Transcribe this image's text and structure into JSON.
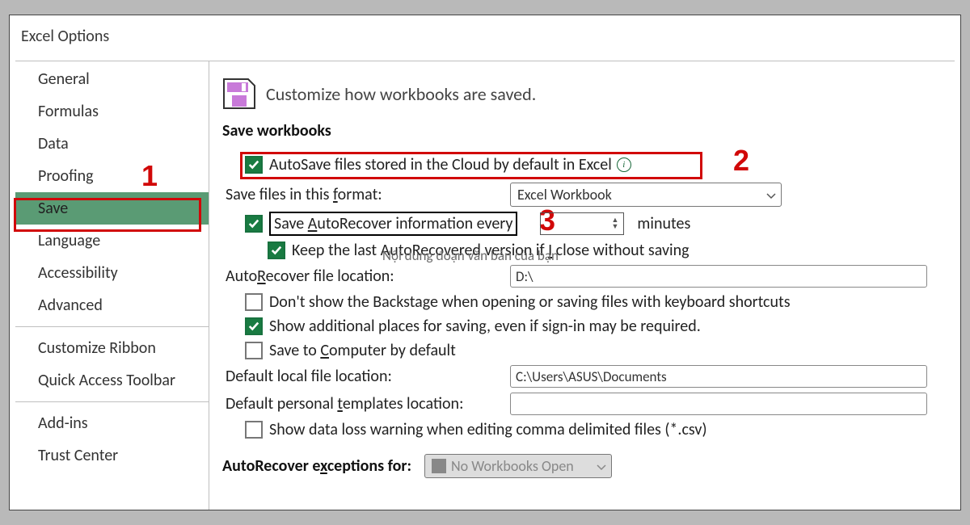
{
  "window_title": "Excel Options",
  "sidebar": {
    "items": [
      {
        "label": "General"
      },
      {
        "label": "Formulas"
      },
      {
        "label": "Data"
      },
      {
        "label": "Proofing"
      },
      {
        "label": "Save"
      },
      {
        "label": "Language"
      },
      {
        "label": "Accessibility"
      },
      {
        "label": "Advanced"
      },
      {
        "label": "Customize Ribbon"
      },
      {
        "label": "Quick Access Toolbar"
      },
      {
        "label": "Add-ins"
      },
      {
        "label": "Trust Center"
      }
    ]
  },
  "header_text": "Customize how workbooks are saved.",
  "sections": {
    "save_workbooks": {
      "title": "Save workbooks",
      "autosave_cloud_label": "AutoSave files stored in the Cloud by default in Excel",
      "format_label_pre": "Save files in this ",
      "format_label_u": "f",
      "format_label_post": "ormat:",
      "format_value": "Excel Workbook",
      "autorecover_label_pre": "Save ",
      "autorecover_label_u": "A",
      "autorecover_label_post": "utoRecover information every",
      "autorecover_value": "",
      "minutes_label": "minutes",
      "keep_last_label_pre": "Keep the last AutoRecovered version if ",
      "keep_last_label_u": "I",
      "keep_last_label_post": " close without saving",
      "ar_file_loc_label_pre": "Auto",
      "ar_file_loc_label_u": "R",
      "ar_file_loc_label_post": "ecover file location:",
      "ar_file_loc_value": "D:\\",
      "no_backstage_label": "Don't show the Backstage when opening or saving files with keyboard shortcuts",
      "show_places_label_pre": "Show additional places for saving, even if si",
      "show_places_label_u": "g",
      "show_places_label_post": "n-in may be required.",
      "save_computer_label_pre": "Save to ",
      "save_computer_label_u": "C",
      "save_computer_label_post": "omputer by default",
      "default_local_label": "Default local file location:",
      "default_local_value": "C:\\Users\\ASUS\\Documents",
      "default_templates_label_pre": "Default personal ",
      "default_templates_label_u": "t",
      "default_templates_label_post": "emplates location:",
      "default_templates_value": "",
      "csv_warning_label": "Show data loss warning when editing comma delimited files (*.csv)"
    },
    "autorecover_exceptions_label_pre": "AutoRecover e",
    "autorecover_exceptions_label_u": "x",
    "autorecover_exceptions_label_post": "ceptions for:",
    "autorecover_exceptions_value": "No Workbooks Open"
  },
  "watermark_text": "Nội dung đoạn văn bản của bạn",
  "annotations": {
    "num1": "1",
    "num2": "2",
    "num3": "3"
  }
}
